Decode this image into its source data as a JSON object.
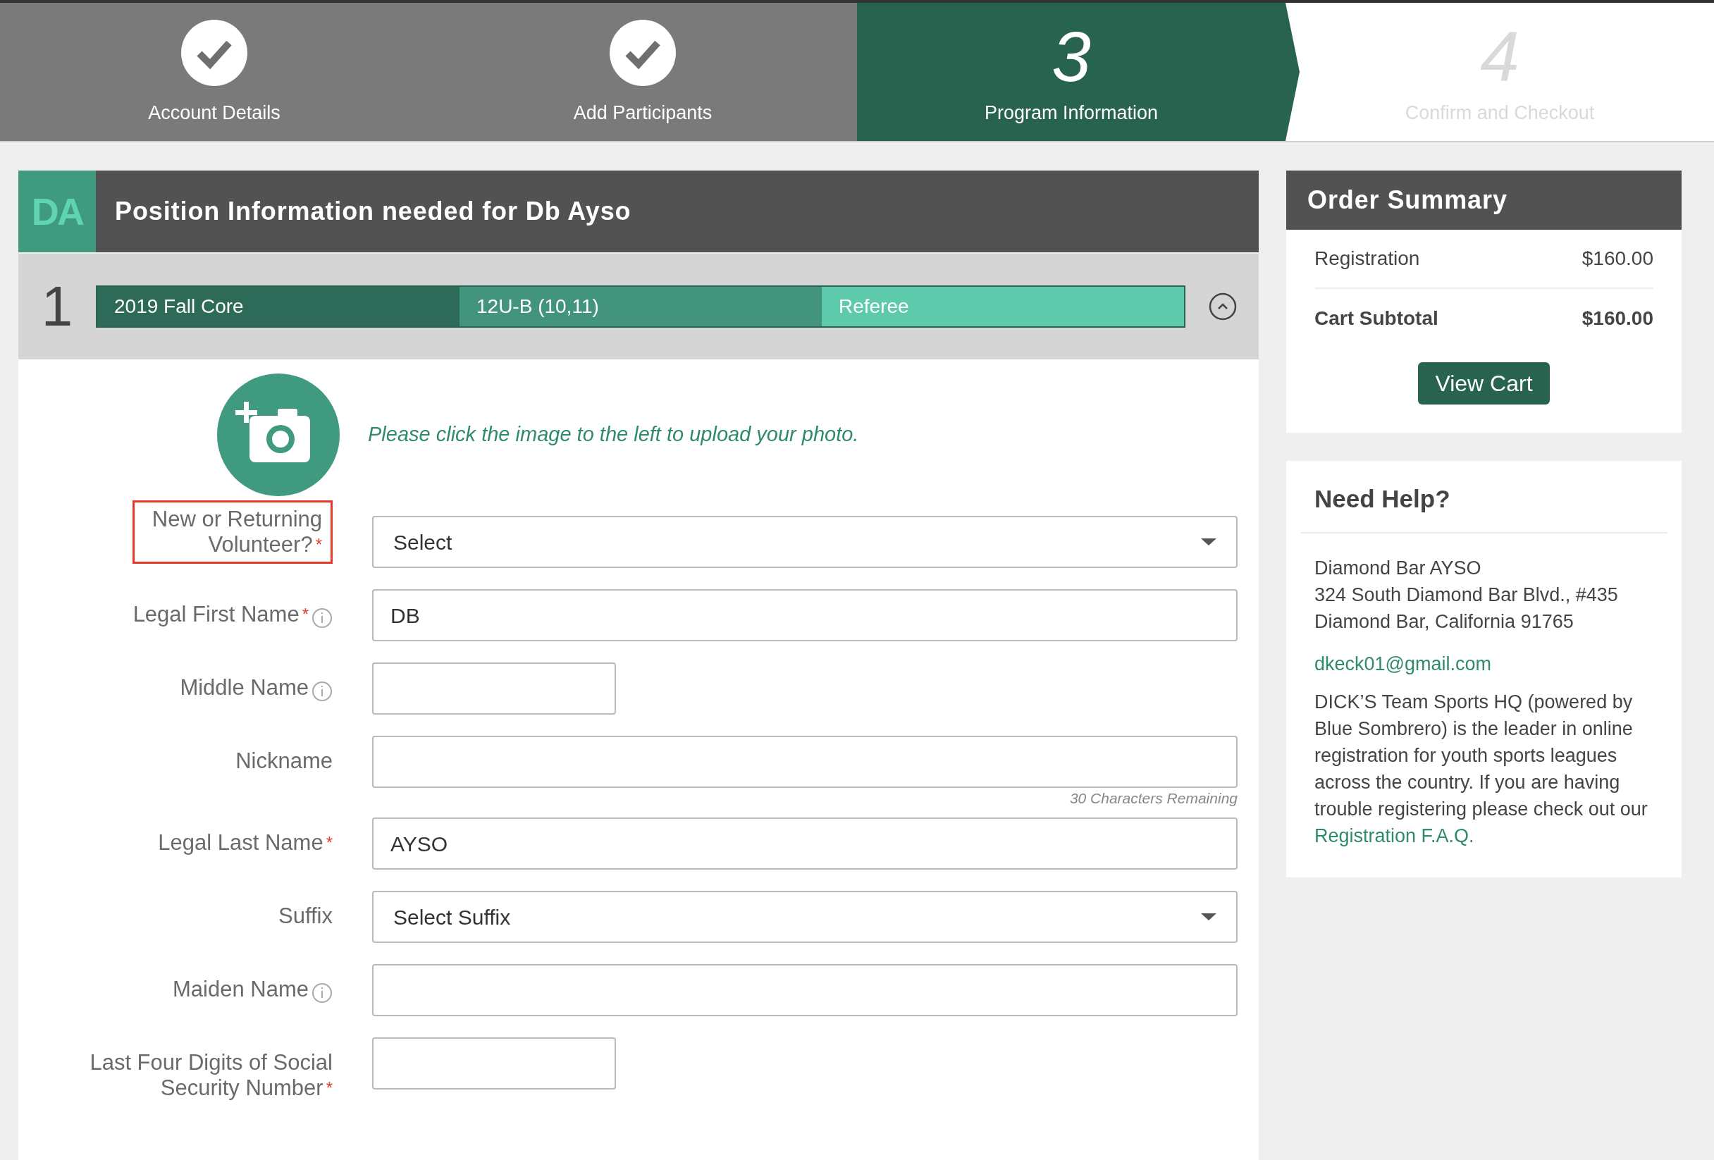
{
  "steps": [
    {
      "label": "Account Details",
      "kind": "complete"
    },
    {
      "label": "Add Participants",
      "kind": "complete"
    },
    {
      "label": "Program Information",
      "kind": "current",
      "number": "3"
    },
    {
      "label": "Confirm and Checkout",
      "kind": "upcoming",
      "number": "4"
    }
  ],
  "panel": {
    "initials": "DA",
    "title": "Position Information needed for Db Ayso",
    "index": "1",
    "breadcrumb": [
      "2019 Fall Core",
      "12U-B (10,11)",
      "Referee"
    ],
    "photo_prompt": "Please click the image to the left to upload your photo.",
    "fields": [
      {
        "label": "New or Returning Volunteer?",
        "kind": "select",
        "required_mark": "*",
        "info": false,
        "highlighted": true,
        "value": "Select"
      },
      {
        "label": "Legal First Name",
        "kind": "text",
        "required_mark": "*",
        "info": true,
        "highlighted": false,
        "value": "DB"
      },
      {
        "label": "Middle Name",
        "kind": "short",
        "info": true,
        "highlighted": false
      },
      {
        "label": "Nickname",
        "kind": "text",
        "info": false,
        "highlighted": false,
        "hint": "30 Characters Remaining"
      },
      {
        "label": "Legal Last Name",
        "kind": "text",
        "required_mark": "*",
        "info": false,
        "highlighted": false,
        "value": "AYSO"
      },
      {
        "label": "Suffix",
        "kind": "select",
        "info": false,
        "highlighted": false,
        "value": "Select Suffix"
      },
      {
        "label": "Maiden Name",
        "kind": "text",
        "info": true,
        "highlighted": false
      },
      {
        "label": "Last Four Digits of Social Security Number",
        "kind": "short",
        "required_mark": "*",
        "info": false,
        "highlighted": false
      }
    ]
  },
  "order_summary": {
    "title": "Order Summary",
    "lines": [
      {
        "label": "Registration",
        "amount": "$160.00",
        "bold": false
      },
      {
        "label": "Cart Subtotal",
        "amount": "$160.00",
        "bold": true
      }
    ],
    "button": "View Cart"
  },
  "help": {
    "title": "Need Help?",
    "address": [
      "Diamond Bar AYSO",
      "324 South Diamond Bar Blvd., #435",
      "Diamond Bar, California 91765"
    ],
    "email": "dkeck01@gmail.com",
    "text": "DICK’S Team Sports HQ (powered by Blue Sombrero) is the leader in online registration for youth sports leagues across the country. If you are having trouble registering please check out our",
    "link": "Registration F.A.Q."
  }
}
